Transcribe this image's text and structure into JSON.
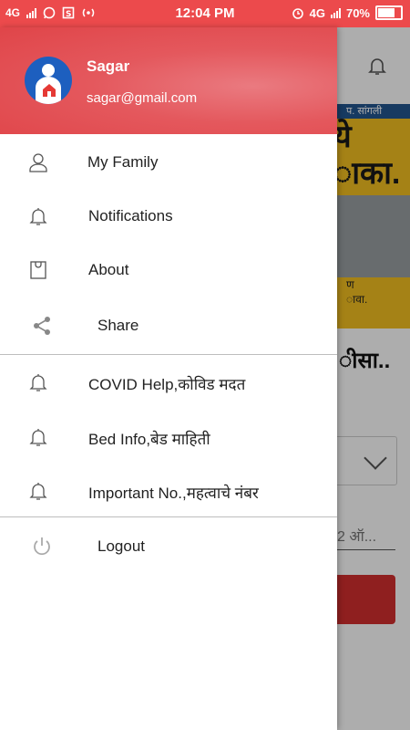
{
  "status_bar": {
    "network": "4G",
    "time": "12:04 PM",
    "network_right": "4G",
    "battery": "70%",
    "icons": [
      "whatsapp-icon",
      "sim-icon",
      "hotspot-icon",
      "alarm-icon",
      "battery-icon"
    ]
  },
  "drawer": {
    "user": {
      "name": "Sagar",
      "email": "sagar@gmail.com"
    },
    "items": [
      {
        "label": "My Family",
        "icon": "person-icon"
      },
      {
        "label": "Notifications",
        "icon": "bell-icon"
      },
      {
        "label": "About",
        "icon": "bag-icon"
      },
      {
        "label": "Share",
        "icon": "share-icon"
      },
      {
        "label": "COVID Help,कोविड मदत",
        "icon": "bell-icon"
      },
      {
        "label": "Bed Info,बेड माहिती",
        "icon": "bell-icon"
      },
      {
        "label": "Important No.,महत्वाचे नंबर",
        "icon": "bell-icon"
      },
      {
        "label": "Logout",
        "icon": "power-icon"
      }
    ]
  },
  "background": {
    "banner_top": "प. सांगली",
    "banner_big_1": "ये",
    "banner_big_2": "ाका.",
    "banner_small_1": "ण",
    "banner_small_2": "ावा.",
    "title_fragment": "ीसा..",
    "input_fragment": "2 ऑ..."
  },
  "colors": {
    "accent": "#ec4a4c",
    "avatar": "#1d5fbf",
    "button": "#d32f2f"
  }
}
